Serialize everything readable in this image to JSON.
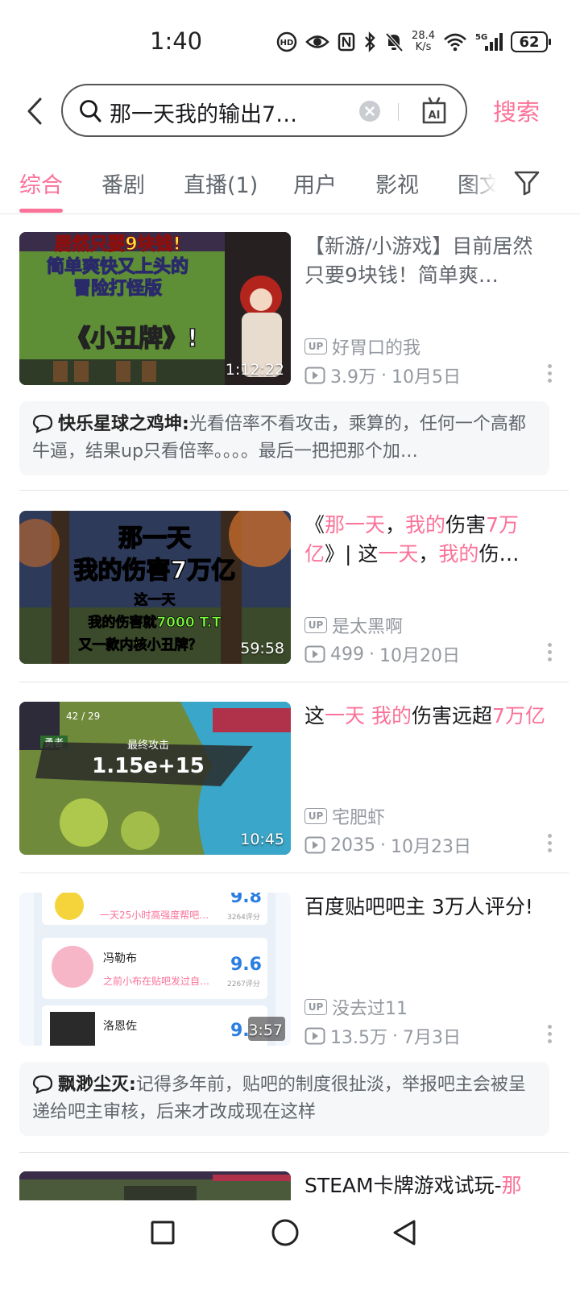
{
  "status": {
    "time": "1:40",
    "net_speed_value": "28.4",
    "net_speed_unit": "K/s",
    "network": "5G",
    "battery": "62"
  },
  "search": {
    "query": "那一天我的输出7…",
    "submit_label": "搜索"
  },
  "tabs": [
    {
      "label": "综合",
      "active": true
    },
    {
      "label": "番剧"
    },
    {
      "label": "直播(1)"
    },
    {
      "label": "用户"
    },
    {
      "label": "影视"
    },
    {
      "label": "图文"
    }
  ],
  "results": [
    {
      "title": "【新游/小游戏】目前居然只要9块钱！简单爽…",
      "uploader": "好胃口的我",
      "views": "3.9万",
      "date": "10月5日",
      "duration": "1:12:22",
      "thumb_caption": "居然只要9块钱！简单爽快又上头的冒险打怪版《小丑牌》!",
      "comment": {
        "user": "快乐星球之鸡坤:",
        "text": "光看倍率不看攻击，乘算的，任何一个高都牛逼，结果up只看倍率。。。。最后一把把那个加…"
      }
    },
    {
      "title_parts": [
        {
          "text": "《",
          "hl": false
        },
        {
          "text": "那一天",
          "hl": true
        },
        {
          "text": "，",
          "hl": false
        },
        {
          "text": "我的",
          "hl": true
        },
        {
          "text": "伤害",
          "hl": false
        },
        {
          "text": "7万亿",
          "hl": true
        },
        {
          "text": "》| 这",
          "hl": false
        },
        {
          "text": "一天",
          "hl": true
        },
        {
          "text": "，",
          "hl": false
        },
        {
          "text": "我的",
          "hl": true
        },
        {
          "text": "伤…",
          "hl": false
        }
      ],
      "uploader": "是太黑啊",
      "views": "499",
      "date": "10月20日",
      "duration": "59:58",
      "thumb_caption": "那一天 我的伤害7万亿 这一天 我的伤害就7000 T.T 又一款内核小丑牌？"
    },
    {
      "title_parts": [
        {
          "text": "这",
          "hl": false
        },
        {
          "text": "一天",
          "hl": true
        },
        {
          "text": " ",
          "hl": false
        },
        {
          "text": "我的",
          "hl": true
        },
        {
          "text": "伤害远超",
          "hl": false
        },
        {
          "text": "7万亿",
          "hl": true
        }
      ],
      "uploader": "宅肥虾",
      "views": "2035",
      "date": "10月23日",
      "duration": "10:45",
      "thumb_caption": "最终攻击 1.15e+15"
    },
    {
      "title": "百度贴吧吧主 3万人评分!",
      "uploader": "没去过11",
      "views": "13.5万",
      "date": "7月3日",
      "duration": "3:57",
      "thumb_rows": [
        {
          "name": "冯勒布",
          "desc": "之前小布在贴吧发过自…",
          "score": "9.6",
          "count": "2267评分"
        },
        {
          "name": "洛恩佐",
          "desc": "",
          "score": "9.",
          "count": ""
        }
      ],
      "thumb_top_desc": "一天25小时高强度帮吧…",
      "thumb_top_score": "9.8",
      "thumb_top_count": "3264评分",
      "comment": {
        "user": "飘渺尘灭:",
        "text": "记得多年前，贴吧的制度很扯淡，举报吧主会被呈递给吧主审核，后来才改成现在这样"
      }
    },
    {
      "title_parts": [
        {
          "text": "STEAM卡牌游戏试玩-",
          "hl": false
        },
        {
          "text": "那",
          "hl": true
        }
      ]
    }
  ],
  "colors": {
    "accent": "#fb7299",
    "secondary_text": "#9499a0"
  }
}
